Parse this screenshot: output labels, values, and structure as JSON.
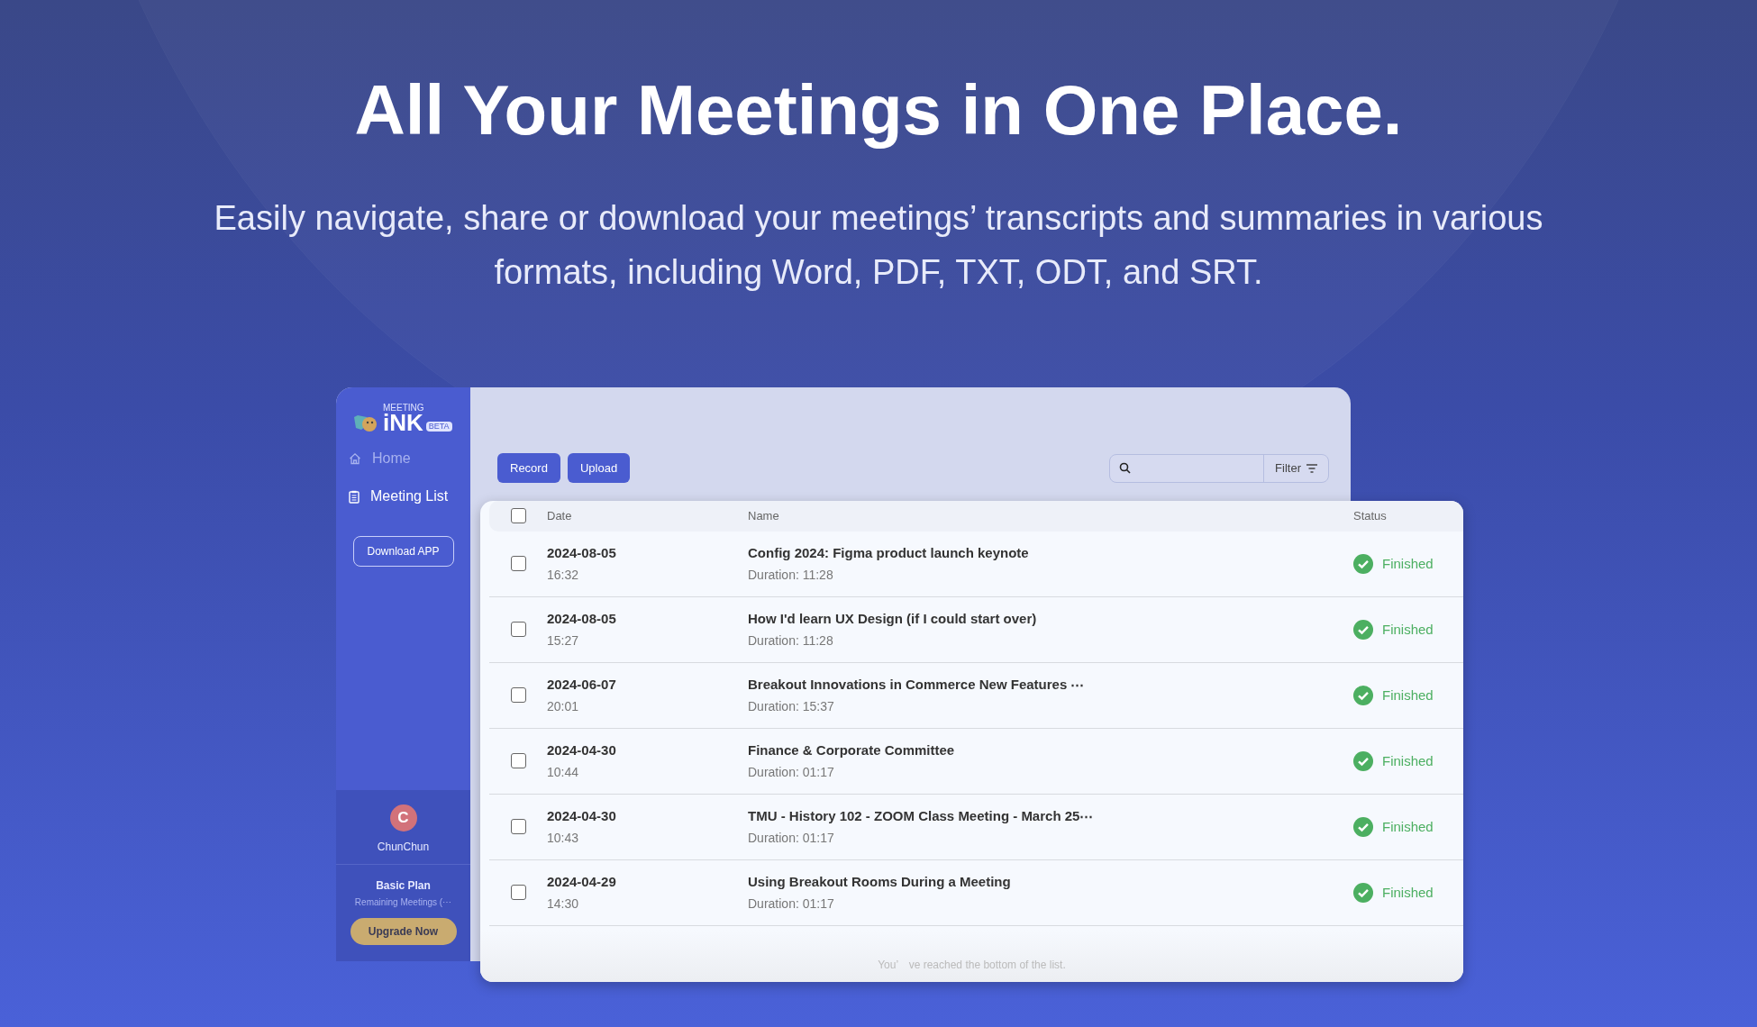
{
  "hero": {
    "title": "All Your Meetings in One Place.",
    "subtitle": "Easily navigate, share or download your meetings’ transcripts and summaries in various formats, including Word, PDF, TXT, ODT, and SRT."
  },
  "sidebar": {
    "logo": {
      "top": "MEETING",
      "main": "iNK",
      "badge": "BETA"
    },
    "items": [
      {
        "label": "Home",
        "kind": "home",
        "selected": false
      },
      {
        "label": "Meeting List",
        "kind": "list",
        "selected": true
      }
    ],
    "download_button": "Download APP",
    "user": {
      "initial": "C",
      "name": "ChunChun"
    },
    "plan": {
      "name": "Basic Plan",
      "remaining": "Remaining Meetings (⋯",
      "upgrade_button": "Upgrade Now"
    }
  },
  "toolbar": {
    "buttons": [
      "Record",
      "Upload"
    ],
    "filter_button": "Filter"
  },
  "table": {
    "select_all_checked": false,
    "columns": [
      "Date",
      "Name",
      "Status"
    ],
    "rows": [
      {
        "checked": false,
        "date": "2024-08-05",
        "time": "16:32",
        "name": "Config 2024: Figma product launch keynote",
        "duration": "Duration: 11:28",
        "status": "Finished",
        "kind": "finished"
      },
      {
        "checked": false,
        "date": "2024-08-05",
        "time": "15:27",
        "name": "How I'd learn UX Design (if I could start over)",
        "duration": "Duration: 11:28",
        "status": "Finished",
        "kind": "finished"
      },
      {
        "checked": false,
        "date": "2024-06-07",
        "time": "20:01",
        "name": "Breakout Innovations in Commerce New Features ⋯",
        "duration": "Duration: 15:37",
        "status": "Finished",
        "kind": "finished"
      },
      {
        "checked": false,
        "date": "2024-04-30",
        "time": "10:44",
        "name": "Finance & Corporate Committee",
        "duration": "Duration: 01:17",
        "status": "Finished",
        "kind": "finished"
      },
      {
        "checked": false,
        "date": "2024-04-30",
        "time": "10:43",
        "name": "TMU - History 102 - ZOOM Class Meeting - March 25⋯",
        "duration": "Duration: 01:17",
        "status": "Finished",
        "kind": "finished"
      },
      {
        "checked": false,
        "date": "2024-04-29",
        "time": "14:30",
        "name": "Using Breakout Rooms During a Meeting",
        "duration": "Duration: 01:17",
        "status": "Finished",
        "kind": "finished"
      }
    ],
    "footer": "You’　ve reached the bottom of the list."
  }
}
